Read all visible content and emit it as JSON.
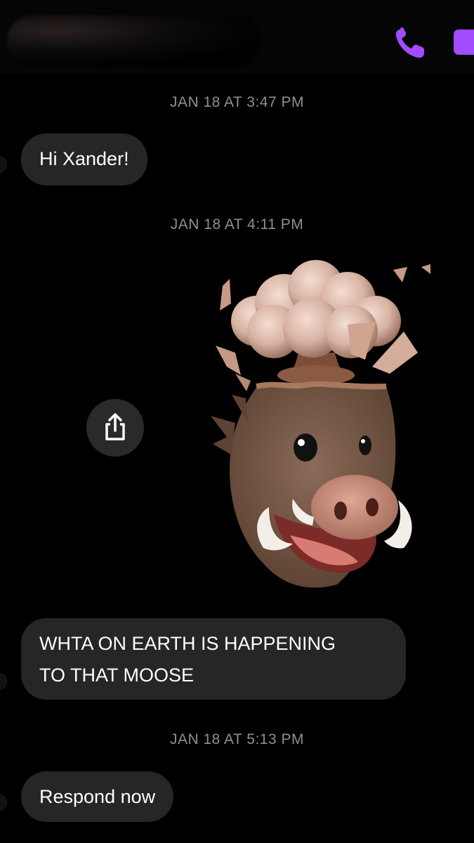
{
  "header": {
    "contact_name": "",
    "call_icon": "phone-icon",
    "video_icon": "video-icon",
    "accent_color": "#a24bff"
  },
  "messages": [
    {
      "timestamp": "JAN 18 AT 3:47 PM",
      "text": "Hi Xander!"
    },
    {
      "timestamp": "JAN 18 AT 4:11 PM",
      "sticker": "exploding-head-boar-memoji"
    },
    {
      "text_line1": "WHTA ON EARTH IS HAPPENING",
      "text_line2": "TO THAT MOOSE"
    },
    {
      "timestamp": "JAN 18 AT 5:13 PM",
      "text": "Respond now"
    }
  ],
  "share_icon": "share-icon",
  "colors": {
    "background": "#000000",
    "bubble": "#262628",
    "timestamp": "#8e8e93"
  }
}
